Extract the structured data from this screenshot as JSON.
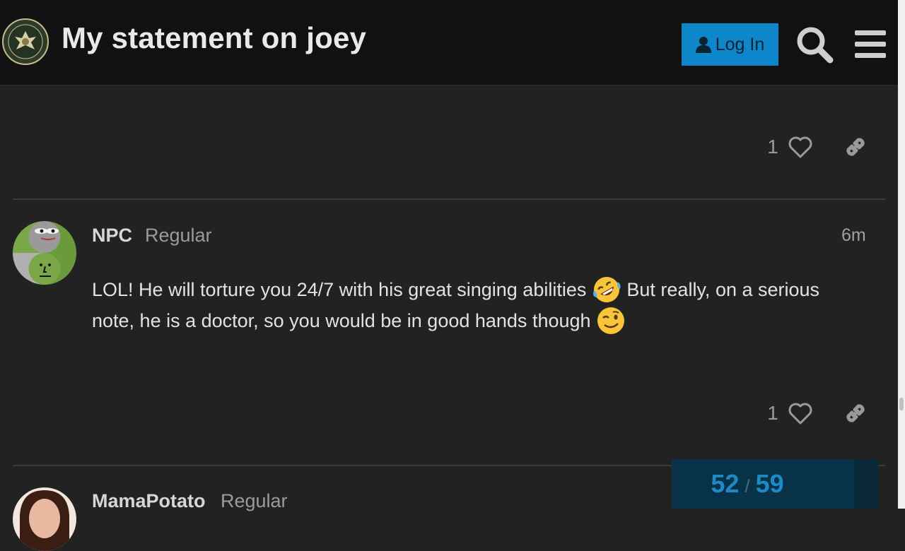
{
  "header": {
    "title": "My statement on joey",
    "login_label": "Log In",
    "logo_text_top": "INFOWARS",
    "logo_text_bottom": "ARMY"
  },
  "colors": {
    "background": "#222222",
    "header_bg": "#111111",
    "accent": "#0e86ca",
    "progress_text": "#1e8ac5"
  },
  "icons": {
    "login": "user-icon",
    "search": "search-icon",
    "menu": "hamburger-menu-icon",
    "like": "heart-icon",
    "share": "link-icon"
  },
  "posts": [
    {
      "likes": "1"
    },
    {
      "username": "NPC",
      "user_title": "Regular",
      "time": "6m",
      "body_part1": "LOL! He will torture you 24/7 with his great singing abilities",
      "body_part2": "But really, on a serious note, he is a doctor, so you would be in good hands though",
      "emojis": [
        "rolling-on-floor-laughing",
        "winking-face"
      ],
      "likes": "1"
    },
    {
      "username": "MamaPotato",
      "user_title": "Regular"
    }
  ],
  "progress": {
    "current": "52",
    "separator": "/",
    "total": "59",
    "fraction": 0.881
  }
}
